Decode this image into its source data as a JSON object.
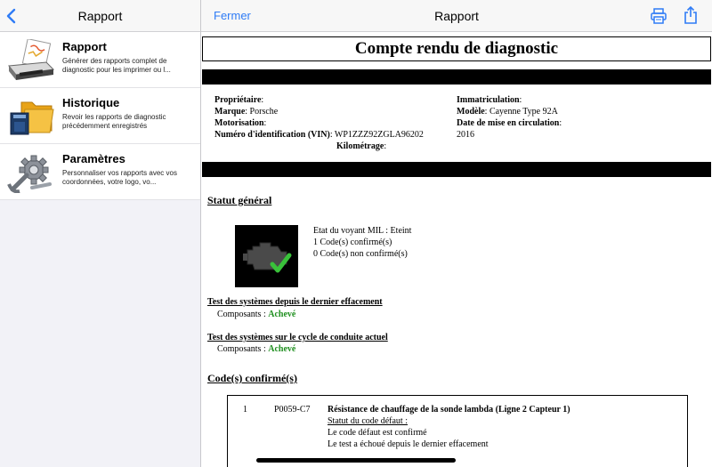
{
  "left_panel": {
    "title": "Rapport",
    "items": [
      {
        "title": "Rapport",
        "desc": "Générer des rapports complet de diagnostic pour les imprimer ou l..."
      },
      {
        "title": "Historique",
        "desc": "Revoir les rapports de diagnostic précédemment enregistrés"
      },
      {
        "title": "Paramètres",
        "desc": "Personnaliser vos rapports avec vos coordonnées, votre logo, vo..."
      }
    ]
  },
  "right_panel": {
    "close_label": "Fermer",
    "title": "Rapport"
  },
  "report": {
    "title": "Compte rendu de diagnostic",
    "owner_label": "Propriétaire",
    "owner_value": "",
    "brand_label": "Marque",
    "brand_value": "Porsche",
    "engine_label": "Motorisation",
    "engine_value": "",
    "vin_label": "Numéro d'identification (VIN)",
    "vin_value": "WP1ZZZ92ZGLA96202",
    "mileage_label": "Kilométrage",
    "mileage_value": "",
    "plate_label": "Immatriculation",
    "plate_value": "",
    "model_label": "Modèle",
    "model_value": "Cayenne Type 92A",
    "date_label": "Date de mise en circulation",
    "date_value": "2016",
    "status_title": "Statut général",
    "mil_state": "Etat du voyant MIL : Eteint",
    "confirmed_count": "1 Code(s) confirmé(s)",
    "unconfirmed_count": "0 Code(s) non confirmé(s)",
    "test1_title": "Test des systèmes depuis le dernier effacement",
    "test1_label": "Composants : ",
    "test1_value": "Achevé",
    "test2_title": "Test des systèmes sur le cycle de conduite actuel",
    "test2_label": "Composants : ",
    "test2_value": "Achevé",
    "codes_title": "Code(s) confirmé(s)",
    "codes": [
      {
        "index": "1",
        "code": "P0059-C7",
        "description": "Résistance de chauffage de la sonde lambda (Ligne 2 Capteur 1)",
        "status_label": "Statut du code défaut :",
        "status_lines": [
          "Le code défaut est confirmé",
          "Le test a échoué depuis le dernier effacement"
        ]
      }
    ]
  },
  "colors": {
    "accent": "#2f7cf6",
    "complete": "#1f8f1f",
    "check": "#39c13a"
  }
}
